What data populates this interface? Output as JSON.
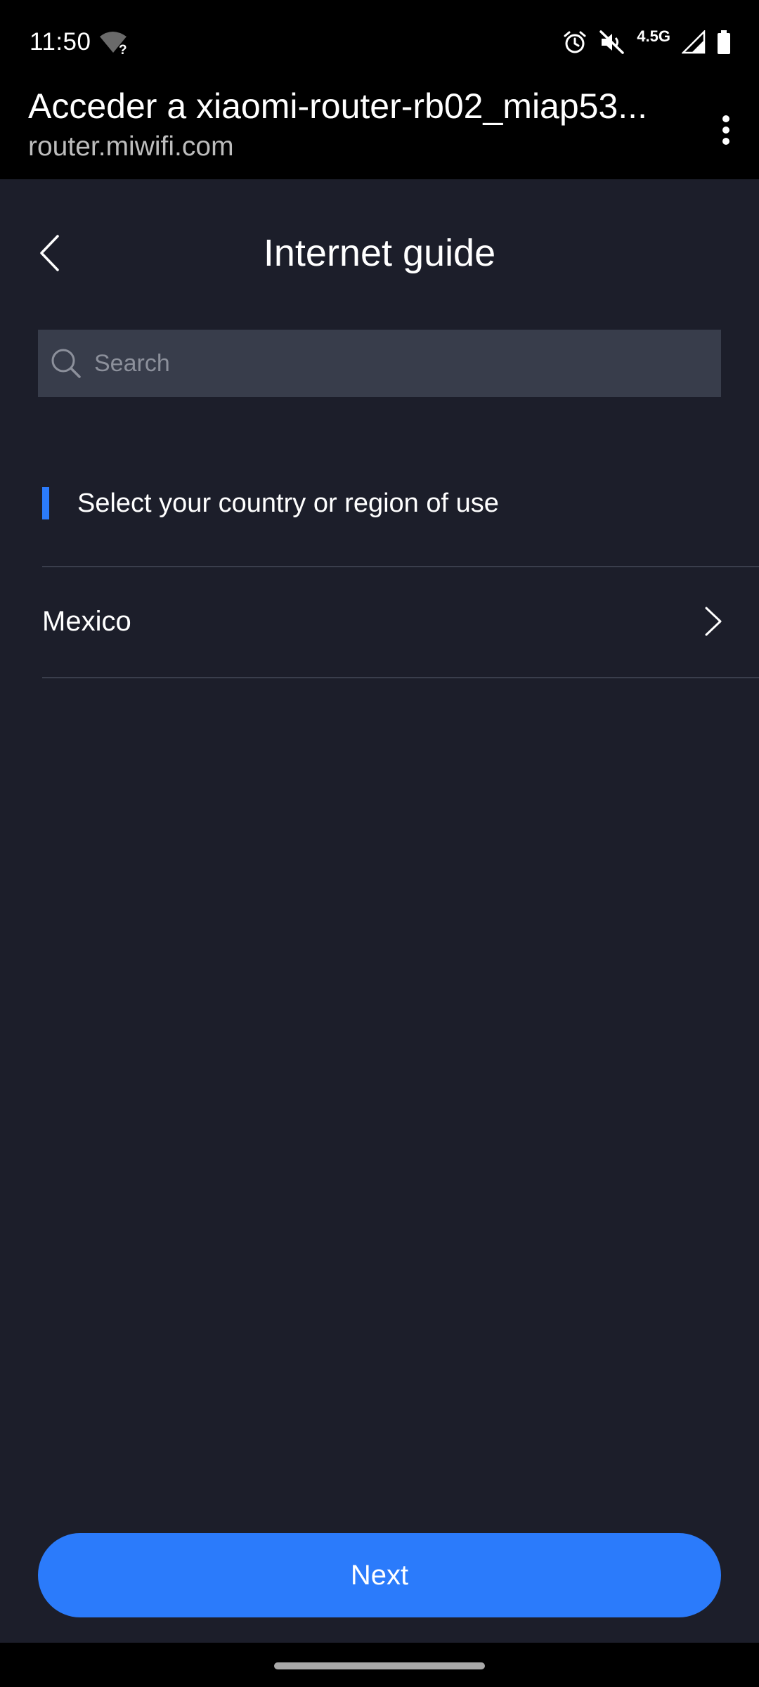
{
  "status_bar": {
    "time": "11:50",
    "wifi_hint": "?",
    "network": "4.5G",
    "icons": [
      "wifi-unknown-icon",
      "alarm-icon",
      "mute-icon",
      "signal-icon",
      "battery-icon"
    ]
  },
  "browser": {
    "title": "Acceder a xiaomi-router-rb02_miap53...",
    "url": "router.miwifi.com",
    "menu_icon": "more-vert-icon"
  },
  "page": {
    "title": "Internet guide",
    "search_placeholder": "Search",
    "section_label": "Select your country or region of use",
    "country": "Mexico",
    "next_label": "Next"
  },
  "colors": {
    "background": "#1c1e2a",
    "search_bg": "#383d4b",
    "accent": "#2b7bfb",
    "divider": "#3a3e4c"
  }
}
